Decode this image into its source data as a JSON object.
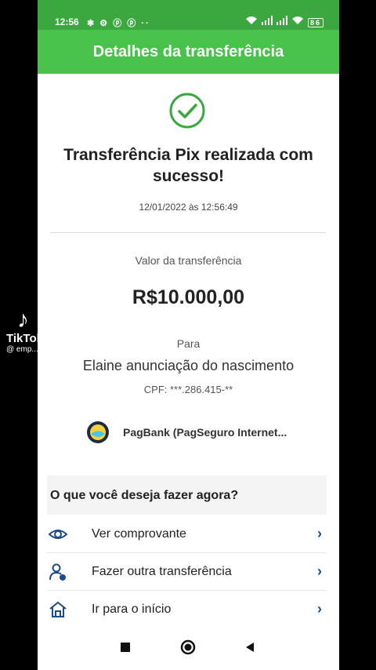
{
  "status_bar": {
    "time": "12:56",
    "left_icons": "✱ ⚙ ⓟ ⓟ ··",
    "right_icons": "wifi ..ıl ..ıl wifi",
    "battery": "86"
  },
  "app_bar": {
    "title": "Detalhes da transferência"
  },
  "receipt": {
    "headline": "Transferência Pix realizada com sucesso!",
    "datetime": "12/01/2022 às 12:56:49",
    "amount_label": "Valor da transferência",
    "amount": "R$10.000,00",
    "to_label": "Para",
    "recipient_name": "Elaine anunciação do nascimento",
    "recipient_cpf": "CPF: ***.286.415-**",
    "bank_name": "PagBank (PagSeguro Internet..."
  },
  "actions_section": {
    "title": "O que você deseja fazer agora?",
    "items": [
      {
        "label": "Ver comprovante",
        "icon": "eye-icon"
      },
      {
        "label": "Fazer outra transferência",
        "icon": "person-transfer-icon"
      },
      {
        "label": "Ir para o início",
        "icon": "home-icon"
      }
    ]
  },
  "overlay": {
    "brand": "TikTok",
    "handle": "@ emp..."
  },
  "colors": {
    "brand_green": "#48c24a",
    "status_green": "#3aa83e",
    "nav_blue": "#1c4a8a"
  }
}
